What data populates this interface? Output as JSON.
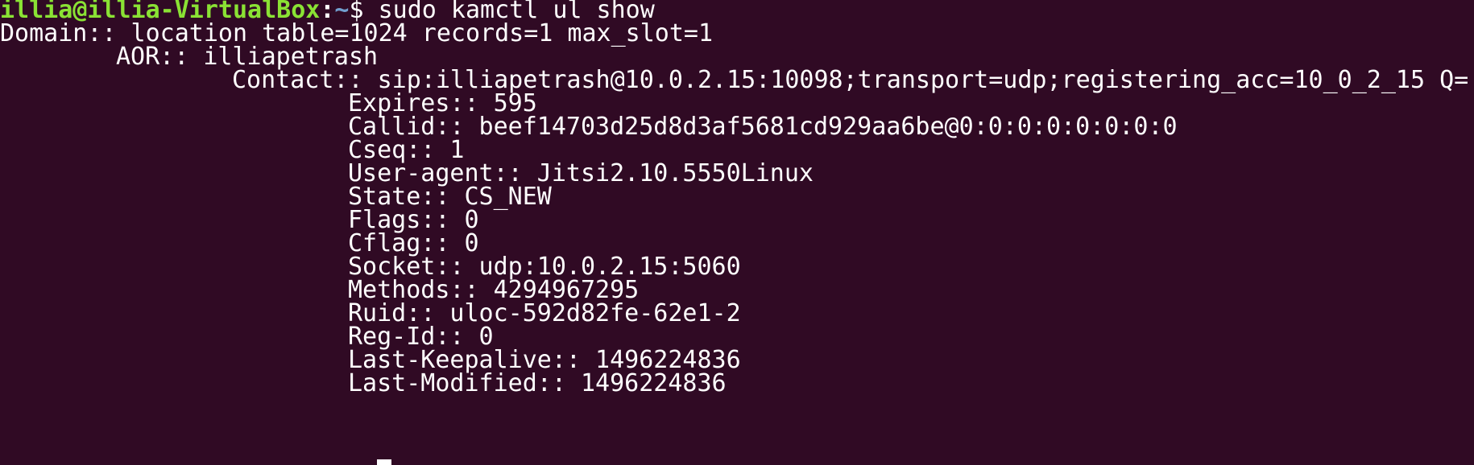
{
  "prompt": {
    "user_host": "illia@illia-VirtualBox",
    "separator": ":",
    "path": "~",
    "symbol": "$ ",
    "command": "sudo kamctl ul show"
  },
  "output": {
    "domain": "Domain:: location table=1024 records=1 max_slot=1",
    "aor": "AOR:: illiapetrash",
    "contact": "Contact:: sip:illiapetrash@10.0.2.15:10098;transport=udp;registering_acc=10_0_2_15 Q=",
    "fields": [
      "Expires:: 595",
      "Callid:: beef14703d25d8d3af5681cd929aa6be@0:0:0:0:0:0:0:0",
      "Cseq:: 1",
      "User-agent:: Jitsi2.10.5550Linux",
      "State:: CS_NEW",
      "Flags:: 0",
      "Cflag:: 0",
      "Socket:: udp:10.0.2.15:5060",
      "Methods:: 4294967295",
      "Ruid:: uloc-592d82fe-62e1-2",
      "Reg-Id:: 0",
      "Last-Keepalive:: 1496224836",
      "Last-Modified:: 1496224836"
    ]
  },
  "colors": {
    "background": "#300a24",
    "text": "#ffffff",
    "prompt_user": "#8ae234",
    "prompt_path": "#729fcf"
  }
}
